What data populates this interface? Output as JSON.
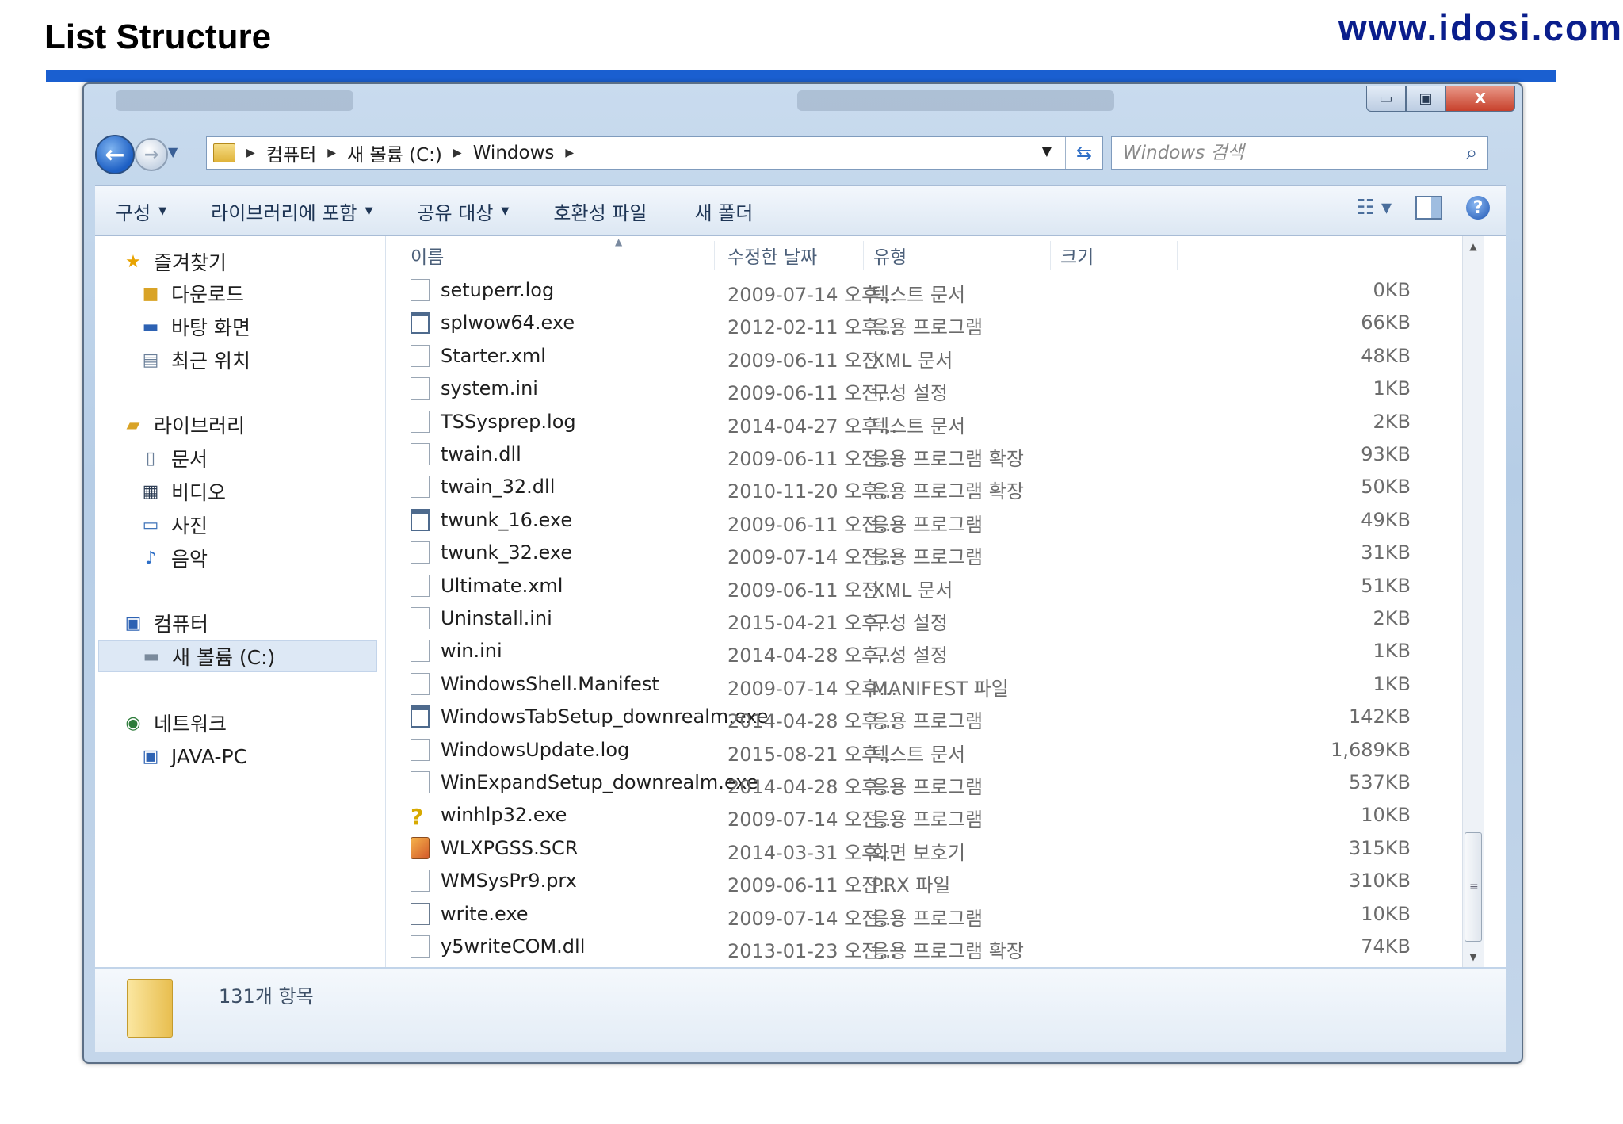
{
  "slide": {
    "title": "List Structure",
    "website": "www.idosi.com"
  },
  "window": {
    "caption_buttons": {
      "minimize": "▭",
      "maximize": "▣",
      "close": "X"
    },
    "address": {
      "crumbs": [
        "컴퓨터",
        "새 볼륨 (C:)",
        "Windows"
      ]
    },
    "search": {
      "placeholder": "Windows 검색"
    },
    "command_bar": {
      "organize": "구성",
      "include_in_library": "라이브러리에 포함",
      "share_with": "공유 대상",
      "compatibility_files": "호환성 파일",
      "new_folder": "새 폴더"
    },
    "nav_pane": {
      "favorites": {
        "label": "즐겨찾기",
        "items": [
          "다운로드",
          "바탕 화면",
          "최근 위치"
        ]
      },
      "libraries": {
        "label": "라이브러리",
        "items": [
          "문서",
          "비디오",
          "사진",
          "음악"
        ]
      },
      "computer": {
        "label": "컴퓨터",
        "items": [
          "새 볼륨 (C:)"
        ]
      },
      "network": {
        "label": "네트워크",
        "items": [
          "JAVA-PC"
        ]
      }
    },
    "columns": {
      "name": "이름",
      "date": "수정한 날짜",
      "type": "유형",
      "size": "크기"
    },
    "files": [
      {
        "name": "setuperr.log",
        "date": "2009-07-14 오후...",
        "type": "텍스트 문서",
        "size": "0KB",
        "icon": "log"
      },
      {
        "name": "splwow64.exe",
        "date": "2012-02-11 오후...",
        "type": "응용 프로그램",
        "size": "66KB",
        "icon": "exe"
      },
      {
        "name": "Starter.xml",
        "date": "2009-06-11 오전...",
        "type": "XML 문서",
        "size": "48KB",
        "icon": "xml"
      },
      {
        "name": "system.ini",
        "date": "2009-06-11 오전...",
        "type": "구성 설정",
        "size": "1KB",
        "icon": "ini"
      },
      {
        "name": "TSSysprep.log",
        "date": "2014-04-27 오후...",
        "type": "텍스트 문서",
        "size": "2KB",
        "icon": "log"
      },
      {
        "name": "twain.dll",
        "date": "2009-06-11 오전...",
        "type": "응용 프로그램 확장",
        "size": "93KB",
        "icon": "dll"
      },
      {
        "name": "twain_32.dll",
        "date": "2010-11-20 오후...",
        "type": "응용 프로그램 확장",
        "size": "50KB",
        "icon": "dll"
      },
      {
        "name": "twunk_16.exe",
        "date": "2009-06-11 오전...",
        "type": "응용 프로그램",
        "size": "49KB",
        "icon": "exe"
      },
      {
        "name": "twunk_32.exe",
        "date": "2009-07-14 오전...",
        "type": "응용 프로그램",
        "size": "31KB",
        "icon": "app"
      },
      {
        "name": "Ultimate.xml",
        "date": "2009-06-11 오전...",
        "type": "XML 문서",
        "size": "51KB",
        "icon": "xml"
      },
      {
        "name": "Uninstall.ini",
        "date": "2015-04-21 오후...",
        "type": "구성 설정",
        "size": "2KB",
        "icon": "ini"
      },
      {
        "name": "win.ini",
        "date": "2014-04-28 오후...",
        "type": "구성 설정",
        "size": "1KB",
        "icon": "ini"
      },
      {
        "name": "WindowsShell.Manifest",
        "date": "2009-07-14 오후...",
        "type": "MANIFEST 파일",
        "size": "1KB",
        "icon": "log"
      },
      {
        "name": "WindowsTabSetup_downrealm.exe",
        "date": "2014-04-28 오후...",
        "type": "응용 프로그램",
        "size": "142KB",
        "icon": "exe"
      },
      {
        "name": "WindowsUpdate.log",
        "date": "2015-08-21 오후...",
        "type": "텍스트 문서",
        "size": "1,689KB",
        "icon": "log"
      },
      {
        "name": "WinExpandSetup_downrealm.exe",
        "date": "2014-04-28 오후...",
        "type": "응용 프로그램",
        "size": "537KB",
        "icon": "app"
      },
      {
        "name": "winhlp32.exe",
        "date": "2009-07-14 오전...",
        "type": "응용 프로그램",
        "size": "10KB",
        "icon": "help"
      },
      {
        "name": "WLXPGSS.SCR",
        "date": "2014-03-31 오후...",
        "type": "화면 보호기",
        "size": "315KB",
        "icon": "scr"
      },
      {
        "name": "WMSysPr9.prx",
        "date": "2009-06-11 오전...",
        "type": "PRX 파일",
        "size": "310KB",
        "icon": "log"
      },
      {
        "name": "write.exe",
        "date": "2009-07-14 오전...",
        "type": "응용 프로그램",
        "size": "10KB",
        "icon": "write"
      },
      {
        "name": "y5writeCOM.dll",
        "date": "2013-01-23 오전...",
        "type": "응용 프로그램 확장",
        "size": "74KB",
        "icon": "dll"
      }
    ],
    "status": {
      "item_count": "131개 항목"
    }
  }
}
